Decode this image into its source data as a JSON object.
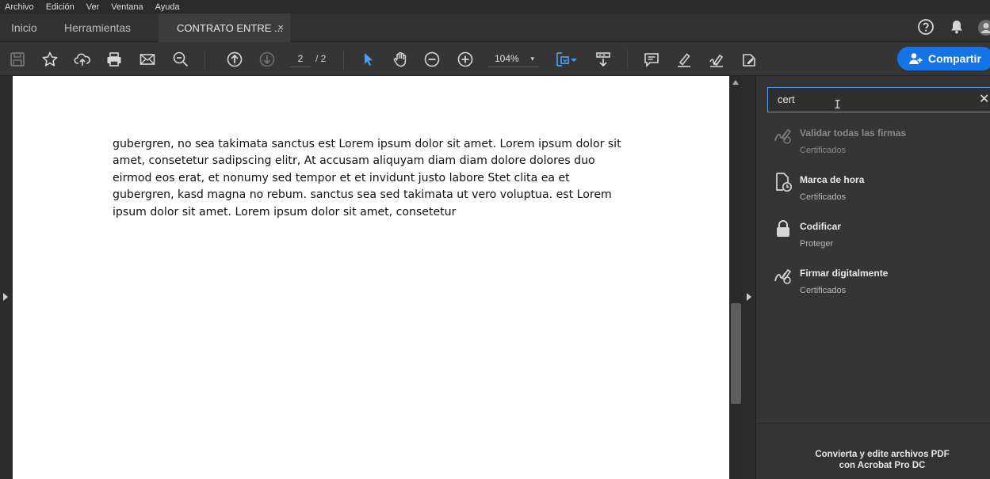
{
  "menu": [
    "Archivo",
    "Edición",
    "Ver",
    "Ventana",
    "Ayuda"
  ],
  "tabs": {
    "home": "Inicio",
    "tools": "Herramientas",
    "document": "CONTRATO ENTRE ...",
    "close_symbol": "×"
  },
  "toolbar": {
    "current_page": "2",
    "total_pages": "/ 2",
    "zoom": "104%",
    "zoom_caret": "▾",
    "share_label": "Compartir",
    "accent_color": "#1473e6"
  },
  "document": {
    "text": "gubergren, no sea takimata sanctus est Lorem ipsum dolor sit amet. Lorem ipsum dolor sit amet, consetetur sadipscing elitr, At accusam aliquyam diam diam dolore dolores duo eirmod eos erat, et nonumy sed tempor et et invidunt justo labore Stet clita ea et gubergren, kasd magna no rebum. sanctus sea sed takimata ut vero voluptua. est Lorem ipsum dolor sit amet. Lorem ipsum dolor sit amet, consetetur"
  },
  "tools_search": {
    "query": "cert",
    "clear_symbol": "✕",
    "results": [
      {
        "title": "Validar todas las firmas",
        "category": "Certificados",
        "icon": "validate-signatures-icon",
        "enabled": false
      },
      {
        "title": "Marca de hora",
        "category": "Certificados",
        "icon": "timestamp-icon",
        "enabled": true
      },
      {
        "title": "Codificar",
        "category": "Proteger",
        "icon": "lock-icon",
        "enabled": true
      },
      {
        "title": "Firmar digitalmente",
        "category": "Certificados",
        "icon": "sign-digitally-icon",
        "enabled": true
      }
    ],
    "promo_line1": "Convierta y edite archivos PDF",
    "promo_line2": "con Acrobat Pro DC"
  }
}
